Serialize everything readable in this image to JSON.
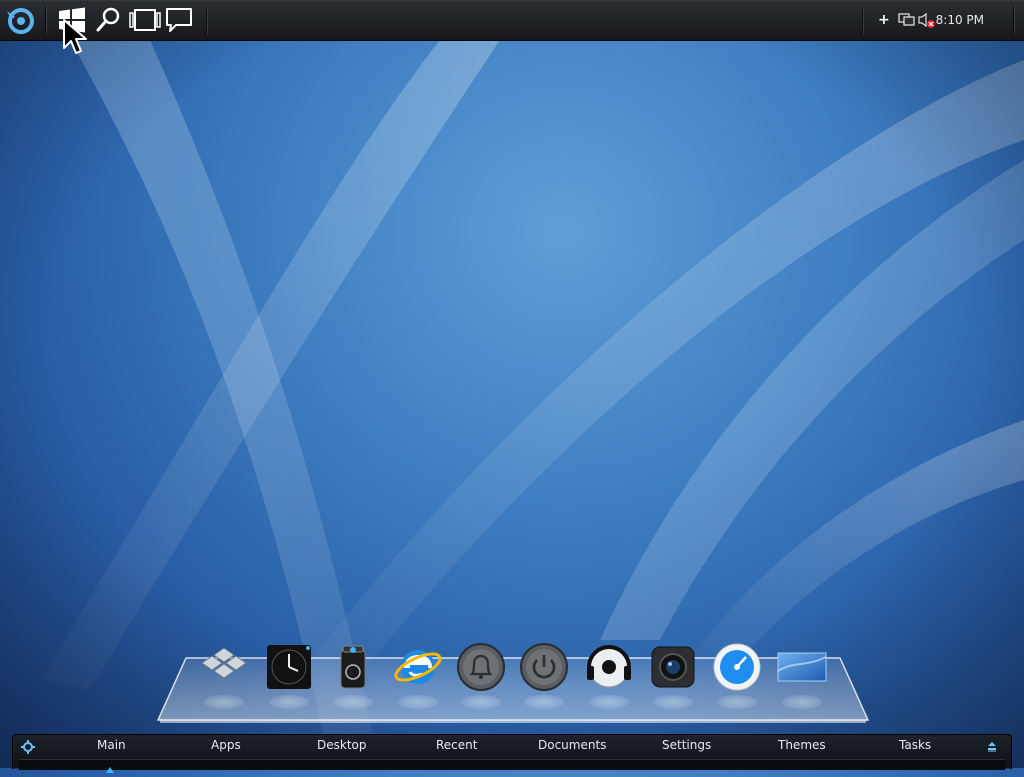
{
  "topbar": {
    "icons": [
      {
        "name": "app-logo-icon"
      },
      {
        "name": "windows-start-icon"
      },
      {
        "name": "search-icon"
      },
      {
        "name": "task-view-icon"
      },
      {
        "name": "message-icon"
      }
    ],
    "tray": {
      "add_symbol": "+",
      "clock": "8:10 PM"
    }
  },
  "dock": {
    "items": [
      {
        "name": "dock-windows-tiles-icon"
      },
      {
        "name": "dock-clock-icon"
      },
      {
        "name": "dock-recycle-bin-icon"
      },
      {
        "name": "dock-internet-explorer-icon"
      },
      {
        "name": "dock-notification-bell-icon"
      },
      {
        "name": "dock-power-icon"
      },
      {
        "name": "dock-music-headphones-icon"
      },
      {
        "name": "dock-camera-icon"
      },
      {
        "name": "dock-speed-dial-icon"
      },
      {
        "name": "dock-desktop-screen-icon"
      }
    ]
  },
  "bottom_menu": {
    "items": [
      {
        "label": "Main",
        "active": true
      },
      {
        "label": "Apps"
      },
      {
        "label": "Desktop"
      },
      {
        "label": "Recent"
      },
      {
        "label": "Documents"
      },
      {
        "label": "Settings"
      },
      {
        "label": "Themes"
      },
      {
        "label": "Tasks"
      }
    ]
  },
  "colors": {
    "accent": "#38b6ff",
    "wallpaper": "#3f7fc2",
    "bar": "#16181b"
  }
}
